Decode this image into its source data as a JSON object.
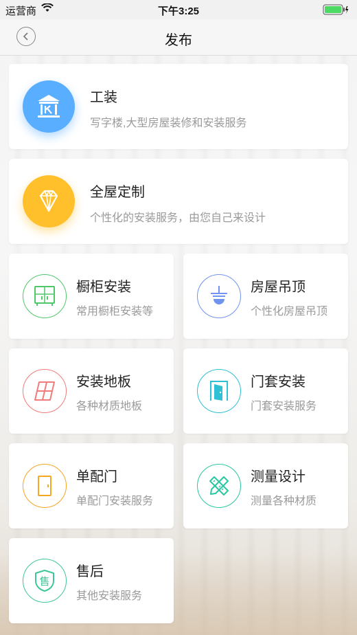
{
  "status_bar": {
    "carrier": "运营商",
    "time": "下午3:25"
  },
  "nav": {
    "title": "发布"
  },
  "items": [
    {
      "title": "工装",
      "subtitle": "写字楼,大型房屋装修和安装服务",
      "icon": "building-icon",
      "color": "#5aaeff"
    },
    {
      "title": "全屋定制",
      "subtitle": "个性化的安装服务，由您自己来设计",
      "icon": "diamond-icon",
      "color": "#ffc02b"
    },
    {
      "title": "橱柜安装",
      "subtitle": "常用橱柜安装等",
      "icon": "cabinet-icon",
      "color": "#4fc86a"
    },
    {
      "title": "房屋吊顶",
      "subtitle": "个性化房屋吊顶",
      "icon": "ceiling-lamp-icon",
      "color": "#6f93ef"
    },
    {
      "title": "安装地板",
      "subtitle": "各种材质地板",
      "icon": "floor-tiles-icon",
      "color": "#f27b7b"
    },
    {
      "title": "门套安装",
      "subtitle": "门套安装服务",
      "icon": "door-frame-icon",
      "color": "#2fc0d4"
    },
    {
      "title": "单配门",
      "subtitle": "单配门安装服务",
      "icon": "door-icon",
      "color": "#f5a623"
    },
    {
      "title": "测量设计",
      "subtitle": "测量各种材质",
      "icon": "ruler-pencil-icon",
      "color": "#2ac7a0"
    },
    {
      "title": "售后",
      "subtitle": "其他安装服务",
      "icon": "after-sales-shield-icon",
      "color": "#3ec69b",
      "glyph": "售"
    }
  ]
}
